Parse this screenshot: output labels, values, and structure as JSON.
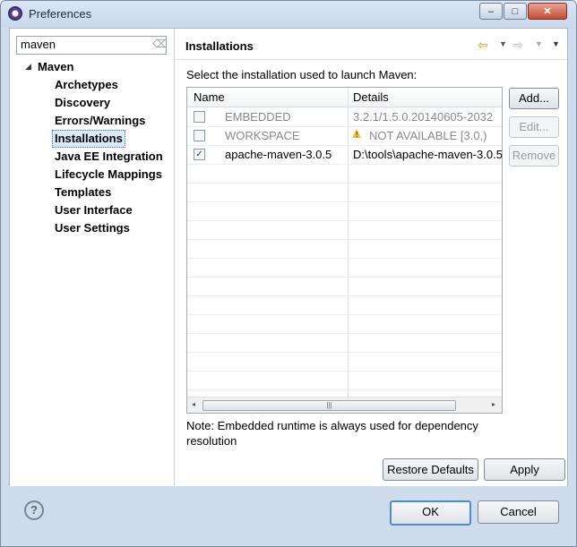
{
  "window": {
    "title": "Preferences",
    "minimize_glyph": "–",
    "maximize_glyph": "□",
    "close_glyph": "✕"
  },
  "filter": {
    "value": "maven",
    "clear_icon_glyph": "⌫"
  },
  "tree": {
    "root": "Maven",
    "expand_glyph": "◢",
    "items": [
      {
        "label": "Archetypes"
      },
      {
        "label": "Discovery"
      },
      {
        "label": "Errors/Warnings"
      },
      {
        "label": "Installations",
        "selected": true
      },
      {
        "label": "Java EE Integration"
      },
      {
        "label": "Lifecycle Mappings"
      },
      {
        "label": "Templates"
      },
      {
        "label": "User Interface"
      },
      {
        "label": "User Settings"
      }
    ]
  },
  "page": {
    "title": "Installations",
    "nav": {
      "back_glyph": "⇦",
      "forward_glyph": "⇨",
      "drop_glyph": "▼",
      "menu_glyph": "▼"
    },
    "description": "Select the installation used to launch Maven:",
    "table": {
      "columns": [
        "Name",
        "Details"
      ],
      "rows": [
        {
          "checked": false,
          "enabled": false,
          "name": "EMBEDDED",
          "details": "3.2.1/1.5.0.20140605-2032"
        },
        {
          "checked": false,
          "enabled": false,
          "name": "WORKSPACE",
          "details": "NOT AVAILABLE [3.0,)",
          "warning": true
        },
        {
          "checked": true,
          "enabled": true,
          "name": "apache-maven-3.0.5",
          "details": "D:\\tools\\apache-maven-3.0.5"
        }
      ],
      "check_glyph": "✓",
      "scroll_left_glyph": "◂",
      "scroll_right_glyph": "▸",
      "scroll_grip_glyph": "|||"
    },
    "buttons": {
      "add": "Add...",
      "edit": "Edit...",
      "remove": "Remove"
    },
    "note": "Note: Embedded runtime is always used for dependency resolution",
    "restore_defaults": "Restore Defaults",
    "apply": "Apply"
  },
  "footer": {
    "help_glyph": "?",
    "ok": "OK",
    "cancel": "Cancel"
  },
  "colors": {
    "selection_border": "#3c6eb4",
    "warning": "#f2c12e",
    "default_button_border": "#4f8bd4",
    "window_frame": "#cfdcec"
  }
}
